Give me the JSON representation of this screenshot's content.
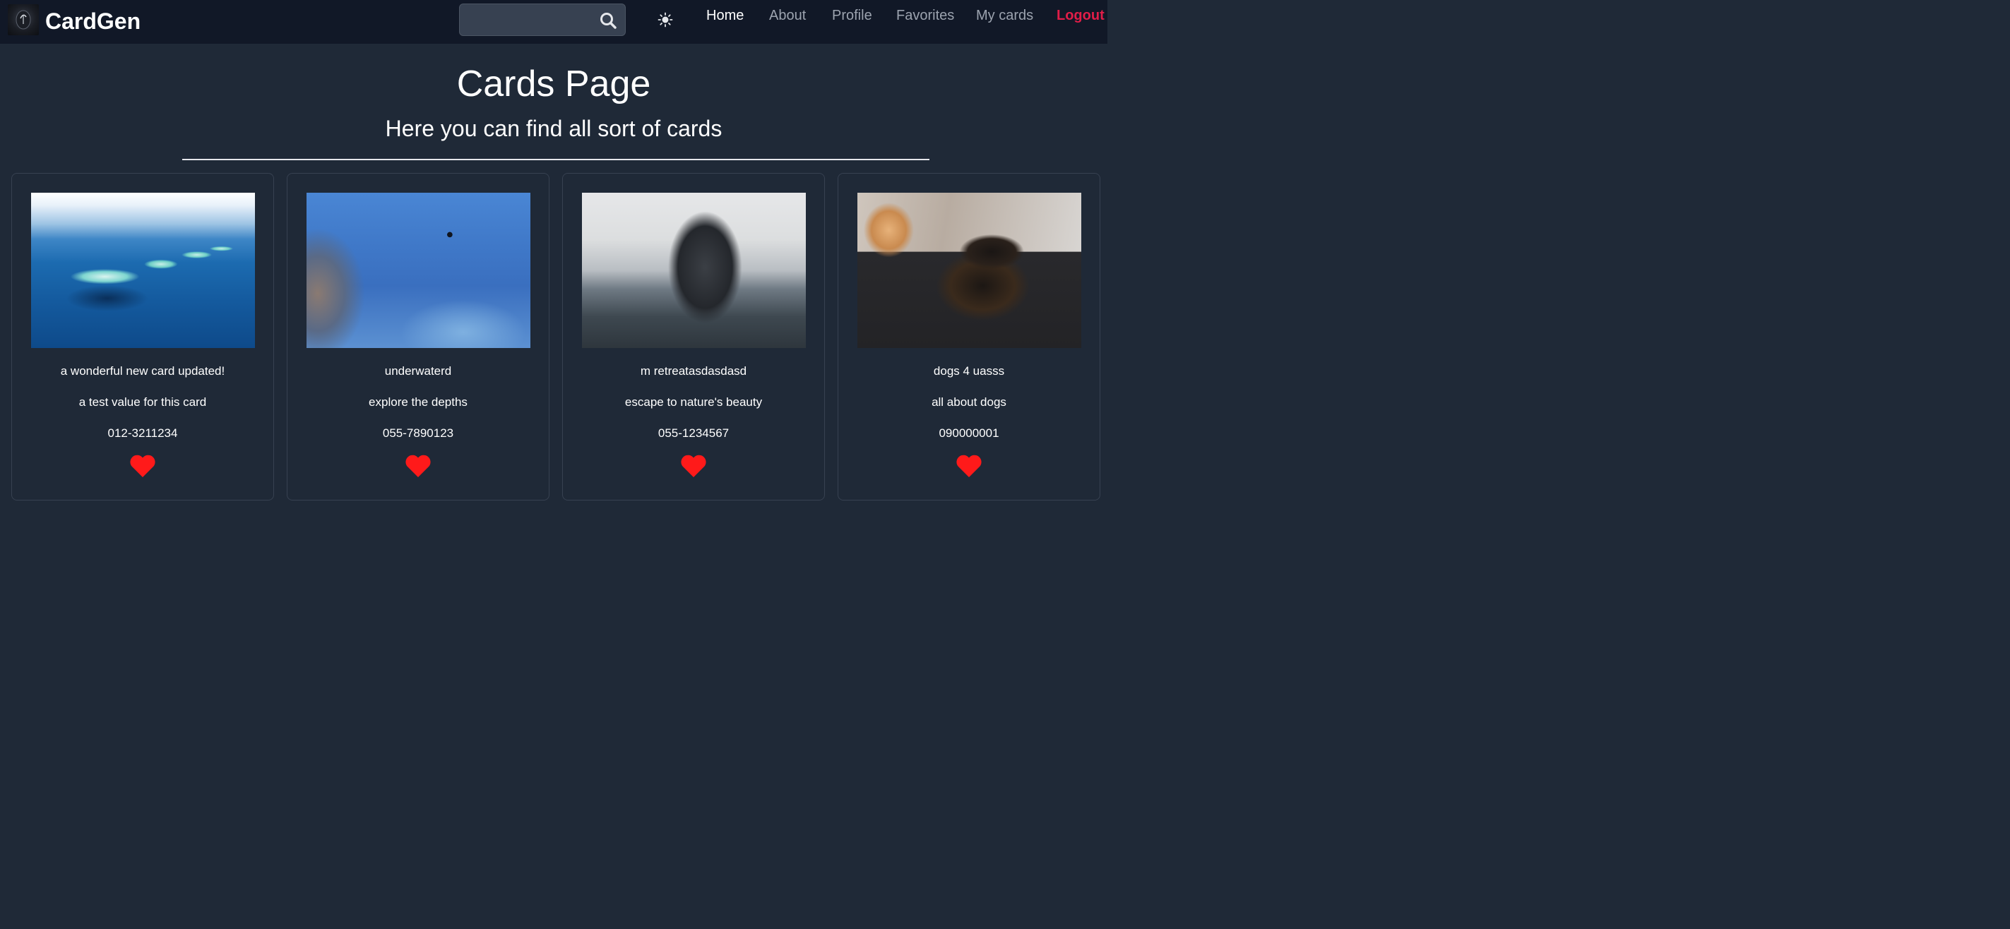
{
  "nav": {
    "brand": "CardGen",
    "search": {
      "value": "",
      "placeholder": ""
    },
    "links": [
      {
        "label": "Home",
        "active": true
      },
      {
        "label": "About",
        "active": false
      },
      {
        "label": "Profile",
        "active": false
      },
      {
        "label": "Favorites",
        "active": false
      },
      {
        "label": "My cards",
        "active": false
      },
      {
        "label": "Logout",
        "active": false
      }
    ],
    "icons": {
      "search": "search-icon",
      "theme": "sun-icon"
    }
  },
  "header": {
    "title": "Cards Page",
    "subtitle": "Here you can find all sort of cards"
  },
  "cards": [
    {
      "title": "a wonderful new card updated!",
      "subtitle": "a test value for this card",
      "phone": "012-3211234",
      "image": "tropical islands aerial view",
      "favorite": true
    },
    {
      "title": "underwaterd",
      "subtitle": "explore the depths",
      "phone": "055-7890123",
      "image": "coral reef with fish and divers",
      "favorite": true
    },
    {
      "title": "m retreatasdasdasd",
      "subtitle": "escape to nature's beauty",
      "phone": "055-1234567",
      "image": "humpback whale breaching",
      "favorite": true
    },
    {
      "title": "dogs 4 uasss",
      "subtitle": "all about dogs",
      "phone": "090000001",
      "image": "black pomeranian dog",
      "favorite": true
    }
  ],
  "colors": {
    "background": "#1f2937",
    "navbar": "#111827",
    "logout": "#e11d48",
    "heart": "#ff1a1a"
  }
}
